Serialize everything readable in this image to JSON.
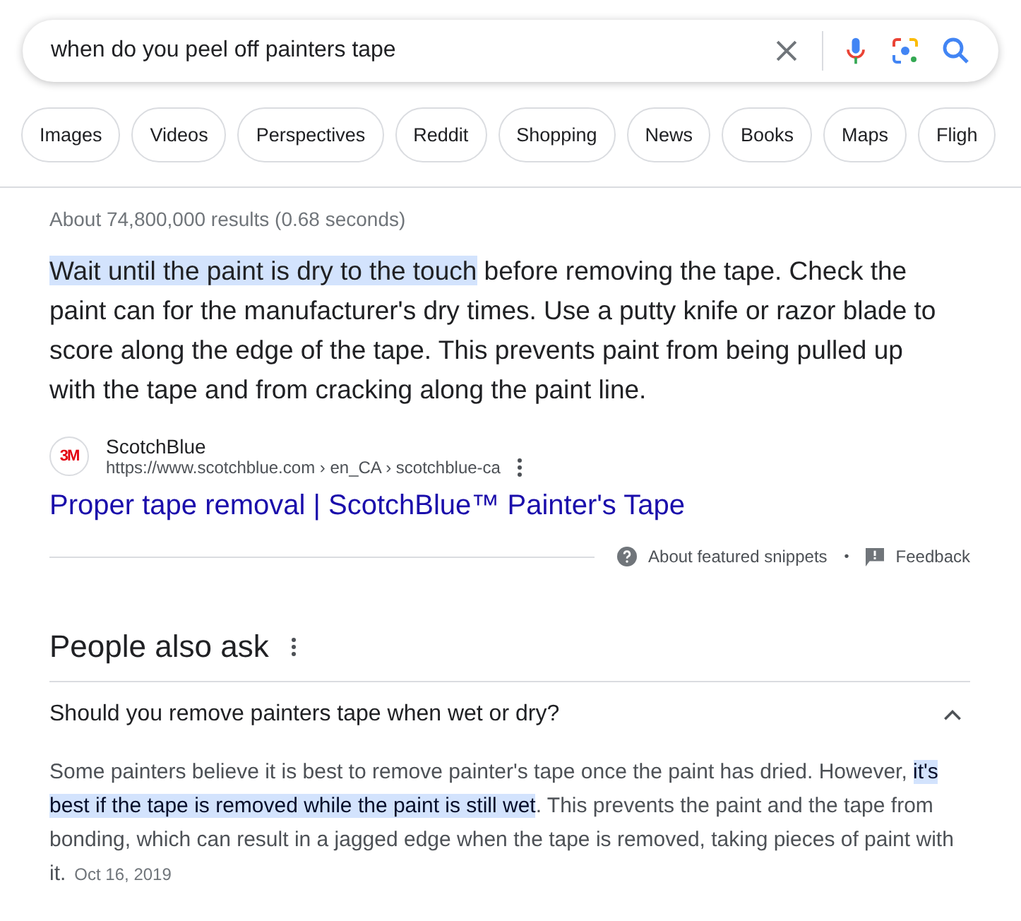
{
  "search": {
    "query": "when do you peel off painters tape"
  },
  "chips": [
    "Images",
    "Videos",
    "Perspectives",
    "Reddit",
    "Shopping",
    "News",
    "Books",
    "Maps",
    "Fligh"
  ],
  "result_stats": "About 74,800,000 results (0.68 seconds)",
  "snippet": {
    "segments": [
      {
        "text": "Wait until the paint is dry to the touch",
        "highlighted": true
      },
      {
        "text": " before removing the tape. Check the paint can for the manufacturer's dry times. Use a putty knife or razor blade to score along the edge of the tape. This prevents paint from being pulled up with the tape and from cracking along the paint line.",
        "highlighted": false
      }
    ],
    "source": {
      "logo_text": "3M",
      "site": "ScotchBlue",
      "url": "https://www.scotchblue.com › en_CA › scotchblue-ca"
    },
    "title": "Proper tape removal | ScotchBlue™ Painter's Tape",
    "about": "About featured snippets",
    "separator": "•",
    "feedback": "Feedback"
  },
  "people_also_ask": {
    "heading": "People also ask",
    "questions": [
      {
        "question": "Should you remove painters tape when wet or dry?",
        "expanded": true,
        "answer": [
          {
            "text": "Some painters believe it is best to remove painter's tape once the paint has dried. However, ",
            "highlighted": false
          },
          {
            "text": "it's best if the tape is removed while the paint is still wet",
            "highlighted": true
          },
          {
            "text": ". This prevents the paint and the tape from bonding, which can result in a jagged edge when the tape is removed, taking pieces of paint with it.",
            "highlighted": false
          }
        ],
        "date": "Oct 16, 2019"
      }
    ]
  }
}
